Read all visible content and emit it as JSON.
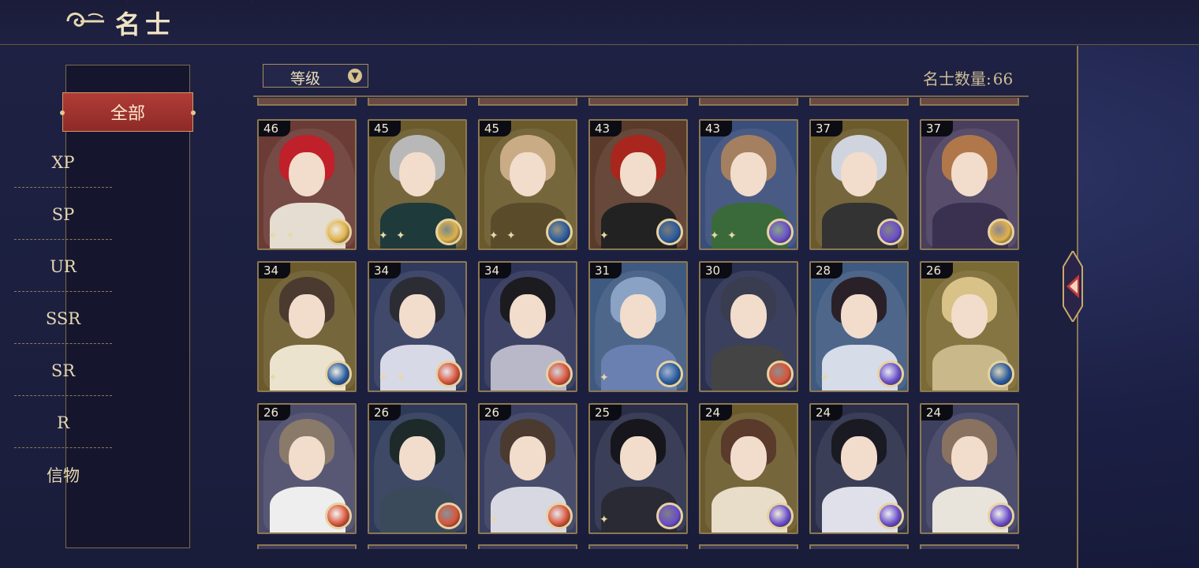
{
  "header": {
    "title": "名士"
  },
  "sidebar": {
    "active": "全部",
    "items": [
      "XP",
      "SP",
      "UR",
      "SSR",
      "SR",
      "R",
      "信物"
    ]
  },
  "sort": {
    "label": "等级"
  },
  "count": {
    "label": "名士数量:",
    "value": "66"
  },
  "colors": {
    "accent_red": "#a83632",
    "gold": "#c9a86a",
    "element_gold": "#e0b24a",
    "element_blue": "#2a5c9e",
    "element_red": "#d8553a",
    "element_purple": "#6a4fc8"
  },
  "cards": [
    {
      "level": "46",
      "bg": "#6b3b36",
      "hair": "#c0202a",
      "body": "#e5ddd2",
      "element": "element_gold",
      "stars": 2
    },
    {
      "level": "45",
      "bg": "#6b5a2c",
      "hair": "#b8b8b8",
      "body": "#1f3a3a",
      "element": "element_gold",
      "stars": 2
    },
    {
      "level": "45",
      "bg": "#6b5a2c",
      "hair": "#c9ab86",
      "body": "#5a4c2a",
      "element": "element_blue",
      "stars": 2
    },
    {
      "level": "43",
      "bg": "#5a3a2a",
      "hair": "#a8261e",
      "body": "#222",
      "element": "element_blue",
      "stars": 1
    },
    {
      "level": "43",
      "bg": "#3a4e7a",
      "hair": "#a48060",
      "body": "#3a6a3a",
      "element": "element_purple",
      "stars": 2
    },
    {
      "level": "37",
      "bg": "#6b5a2c",
      "hair": "#d0d4de",
      "body": "#333",
      "element": "element_purple",
      "stars": 0
    },
    {
      "level": "37",
      "bg": "#4a3e5e",
      "hair": "#b0784a",
      "body": "#3a3050",
      "element": "element_gold",
      "stars": 0
    },
    {
      "level": "34",
      "bg": "#6b5a2c",
      "hair": "#4a3a30",
      "body": "#ece3cf",
      "element": "element_blue",
      "stars": 1
    },
    {
      "level": "34",
      "bg": "#303a5e",
      "hair": "#2c2c34",
      "body": "#d7d9e6",
      "element": "element_red",
      "stars": 2
    },
    {
      "level": "34",
      "bg": "#2e3458",
      "hair": "#1c1c20",
      "body": "#b8b8c8",
      "element": "element_red",
      "stars": 0
    },
    {
      "level": "31",
      "bg": "#3e5a80",
      "hair": "#8aa2c4",
      "body": "#6a80b0",
      "element": "element_blue",
      "stars": 1
    },
    {
      "level": "30",
      "bg": "#2a3050",
      "hair": "#3a3c50",
      "body": "#444",
      "element": "element_red",
      "stars": 0
    },
    {
      "level": "28",
      "bg": "#3e5a80",
      "hair": "#2a2028",
      "body": "#d6dce8",
      "element": "element_purple",
      "stars": 1
    },
    {
      "level": "26",
      "bg": "#7a6a34",
      "hair": "#d8c288",
      "body": "#c8b88a",
      "element": "element_blue",
      "stars": 0
    },
    {
      "level": "26",
      "bg": "#4a4a6a",
      "hair": "#8a7a6a",
      "body": "#eeeeee",
      "element": "element_red",
      "stars": 0
    },
    {
      "level": "26",
      "bg": "#2e3a5a",
      "hair": "#1e2a2a",
      "body": "#3a4a5a",
      "element": "element_red",
      "stars": 0
    },
    {
      "level": "26",
      "bg": "#3a3e60",
      "hair": "#4a3a30",
      "body": "#d8d8e2",
      "element": "element_red",
      "stars": 1
    },
    {
      "level": "25",
      "bg": "#2a2e48",
      "hair": "#16161c",
      "body": "#2a2a34",
      "element": "element_purple",
      "stars": 1
    },
    {
      "level": "24",
      "bg": "#6b5a2c",
      "hair": "#5a3a2a",
      "body": "#e8ddc8",
      "element": "element_purple",
      "stars": 0
    },
    {
      "level": "24",
      "bg": "#2a2e48",
      "hair": "#1a1a22",
      "body": "#e0e0ea",
      "element": "element_purple",
      "stars": 0
    },
    {
      "level": "24",
      "bg": "#3e4060",
      "hair": "#8a7260",
      "body": "#e8e4dc",
      "element": "element_purple",
      "stars": 0
    }
  ]
}
